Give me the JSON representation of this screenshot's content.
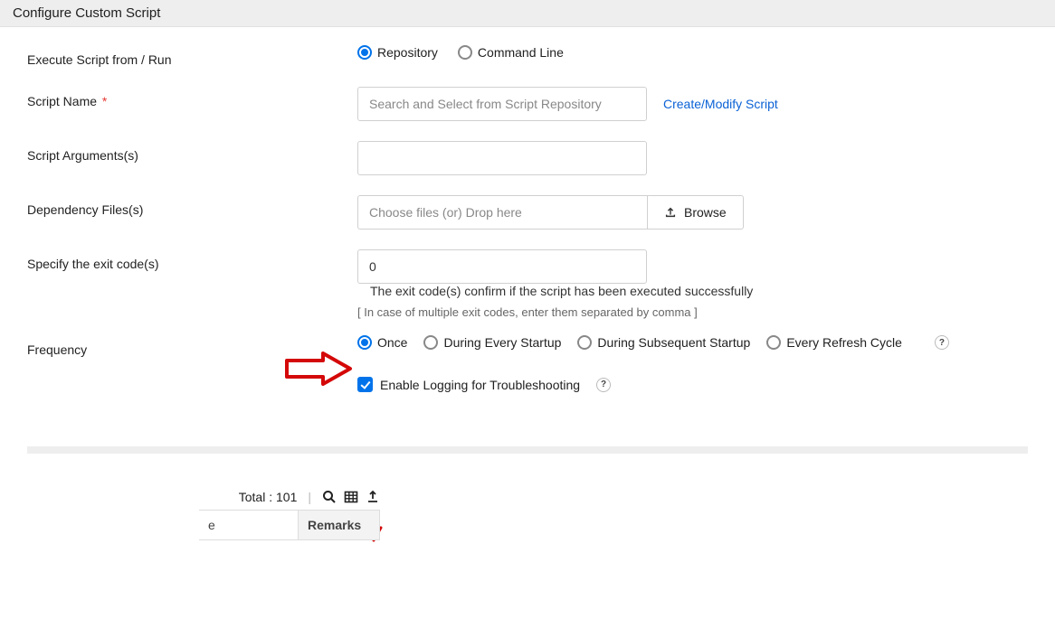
{
  "header": {
    "title": "Configure Custom Script"
  },
  "form": {
    "executeFrom": {
      "label": "Execute Script from / Run",
      "options": {
        "repository": "Repository",
        "commandLine": "Command Line"
      },
      "selected": "repository"
    },
    "scriptName": {
      "label": "Script Name",
      "required": "*",
      "placeholder": "Search and Select from Script Repository",
      "link": "Create/Modify Script"
    },
    "scriptArgs": {
      "label": "Script Arguments(s)",
      "value": ""
    },
    "dependencyFiles": {
      "label": "Dependency Files(s)",
      "dropText": "Choose files (or) Drop here",
      "browse": "Browse"
    },
    "exitCodes": {
      "label": "Specify the exit code(s)",
      "value": "0",
      "sideNote": "The exit code(s) confirm if the script has been executed successfully",
      "hint": "[ In case of multiple exit codes, enter them separated by comma ]"
    },
    "frequency": {
      "label": "Frequency",
      "options": {
        "once": "Once",
        "everyStartup": "During Every Startup",
        "subsequentStartup": "During Subsequent Startup",
        "refreshCycle": "Every Refresh Cycle"
      },
      "selected": "once",
      "help": "?"
    },
    "logging": {
      "label": "Enable Logging for Troubleshooting",
      "checked": true,
      "help": "?"
    }
  },
  "toolbar": {
    "totalLabel": "Total : 101",
    "col_e": "e",
    "col_remarks": "Remarks"
  }
}
